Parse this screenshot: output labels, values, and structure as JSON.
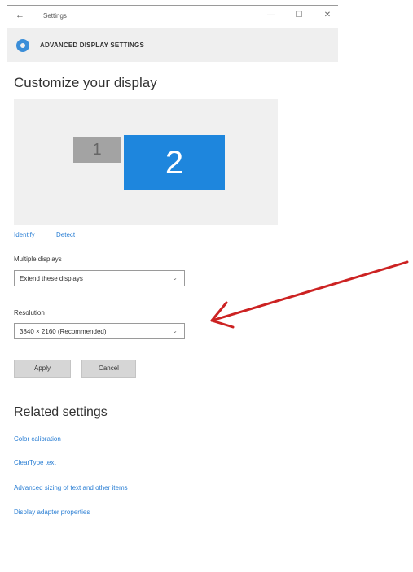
{
  "window": {
    "back_glyph": "←",
    "app_title": "Settings",
    "minimize_glyph": "—",
    "maximize_glyph": "☐",
    "close_glyph": "✕"
  },
  "header": {
    "icon": "gear-icon",
    "title": "ADVANCED DISPLAY SETTINGS"
  },
  "customize": {
    "heading": "Customize your display",
    "monitor1_label": "1",
    "monitor2_label": "2",
    "identify_label": "Identify",
    "detect_label": "Detect"
  },
  "multiple_displays": {
    "label": "Multiple displays",
    "value": "Extend these displays"
  },
  "resolution": {
    "label": "Resolution",
    "value": "3840 × 2160 (Recommended)"
  },
  "buttons": {
    "apply": "Apply",
    "cancel": "Cancel"
  },
  "related": {
    "heading": "Related settings",
    "links": [
      "Color calibration",
      "ClearType text",
      "Advanced sizing of text and other items",
      "Display adapter properties"
    ]
  },
  "colors": {
    "accent": "#1e86dd",
    "link": "#2b7fd4",
    "arrow": "#cc2222"
  },
  "chevron_glyph": "⌄"
}
